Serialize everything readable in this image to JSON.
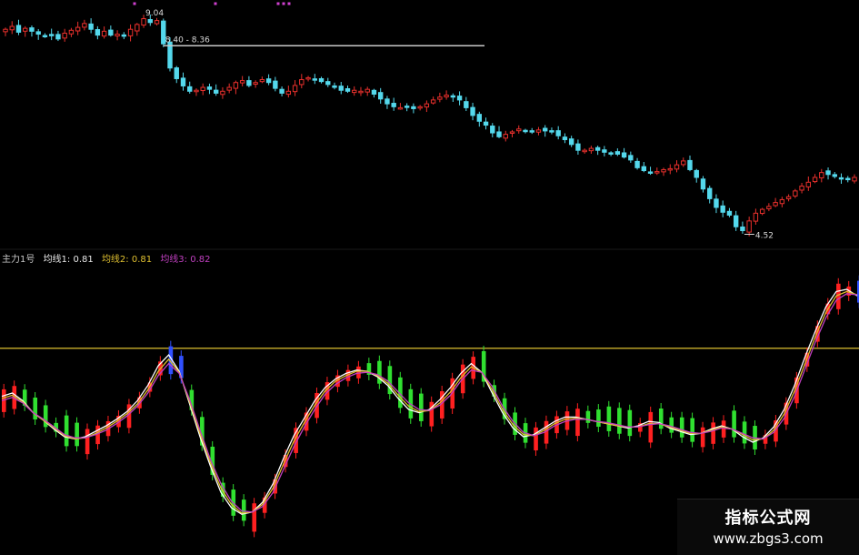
{
  "chart_data": [
    {
      "type": "candlestick",
      "title": "",
      "grid": false,
      "xlabel": "",
      "ylabel": "",
      "ylim": [
        4.4,
        9.1
      ],
      "annotations": {
        "high_label": "9.04",
        "range_label": "8.40 - 8.36",
        "low_label": "4.52"
      },
      "closes": [
        8.72,
        8.78,
        8.66,
        8.74,
        8.68,
        8.62,
        8.58,
        8.6,
        8.52,
        8.64,
        8.7,
        8.76,
        8.84,
        8.72,
        8.6,
        8.68,
        8.6,
        8.62,
        8.58,
        8.72,
        8.82,
        8.94,
        8.86,
        8.9,
        8.42,
        7.92,
        7.7,
        7.55,
        7.44,
        7.46,
        7.52,
        7.48,
        7.4,
        7.44,
        7.52,
        7.62,
        7.66,
        7.56,
        7.62,
        7.68,
        7.62,
        7.5,
        7.4,
        7.44,
        7.56,
        7.68,
        7.72,
        7.68,
        7.64,
        7.58,
        7.52,
        7.46,
        7.44,
        7.46,
        7.44,
        7.48,
        7.38,
        7.28,
        7.18,
        7.12,
        7.1,
        7.12,
        7.08,
        7.12,
        7.18,
        7.26,
        7.32,
        7.36,
        7.32,
        7.26,
        7.1,
        6.94,
        6.82,
        6.74,
        6.58,
        6.5,
        6.55,
        6.6,
        6.66,
        6.62,
        6.6,
        6.64,
        6.62,
        6.62,
        6.52,
        6.44,
        6.34,
        6.22,
        6.22,
        6.26,
        6.22,
        6.18,
        6.16,
        6.14,
        6.08,
        6.02,
        5.86,
        5.8,
        5.76,
        5.78,
        5.82,
        5.84,
        5.92,
        6.0,
        5.82,
        5.66,
        5.42,
        5.22,
        5.04,
        4.94,
        4.88,
        4.64,
        4.56,
        4.76,
        4.92,
        5.0,
        5.06,
        5.14,
        5.2,
        5.26,
        5.38,
        5.48,
        5.56,
        5.66,
        5.76,
        5.72,
        5.68,
        5.64,
        5.62,
        5.66
      ]
    },
    {
      "type": "line",
      "title": "主力1号",
      "grid": false,
      "xlabel": "",
      "ylabel": "",
      "ylim": [
        -0.9,
        1.55
      ],
      "reference_line": 0.86,
      "series": [
        {
          "name": "均线1",
          "label_value": "0.81",
          "color": "#ffffff",
          "values": [
            0.42,
            0.45,
            0.38,
            0.27,
            0.2,
            0.12,
            0.05,
            0.03,
            0.05,
            0.1,
            0.15,
            0.21,
            0.28,
            0.38,
            0.52,
            0.7,
            0.8,
            0.65,
            0.35,
            0.05,
            -0.22,
            -0.46,
            -0.6,
            -0.66,
            -0.64,
            -0.55,
            -0.38,
            -0.15,
            0.06,
            0.22,
            0.38,
            0.5,
            0.58,
            0.63,
            0.66,
            0.65,
            0.6,
            0.52,
            0.4,
            0.3,
            0.27,
            0.3,
            0.39,
            0.5,
            0.63,
            0.72,
            0.64,
            0.45,
            0.27,
            0.13,
            0.05,
            0.07,
            0.13,
            0.19,
            0.23,
            0.23,
            0.21,
            0.19,
            0.17,
            0.15,
            0.13,
            0.15,
            0.19,
            0.18,
            0.13,
            0.1,
            0.07,
            0.08,
            0.12,
            0.15,
            0.12,
            0.05,
            0.0,
            0.04,
            0.14,
            0.3,
            0.52,
            0.78,
            1.02,
            1.24,
            1.38,
            1.4,
            1.34
          ]
        },
        {
          "name": "均线2",
          "label_value": "0.81",
          "color": "#e0c030",
          "values": [
            0.4,
            0.43,
            0.37,
            0.27,
            0.2,
            0.13,
            0.06,
            0.03,
            0.04,
            0.08,
            0.13,
            0.19,
            0.26,
            0.35,
            0.48,
            0.65,
            0.76,
            0.64,
            0.37,
            0.08,
            -0.19,
            -0.42,
            -0.57,
            -0.65,
            -0.64,
            -0.57,
            -0.42,
            -0.2,
            0.01,
            0.18,
            0.34,
            0.47,
            0.56,
            0.61,
            0.65,
            0.65,
            0.61,
            0.54,
            0.43,
            0.33,
            0.28,
            0.29,
            0.36,
            0.46,
            0.59,
            0.69,
            0.64,
            0.48,
            0.3,
            0.16,
            0.07,
            0.06,
            0.11,
            0.17,
            0.21,
            0.22,
            0.21,
            0.19,
            0.17,
            0.15,
            0.14,
            0.14,
            0.17,
            0.17,
            0.14,
            0.11,
            0.08,
            0.08,
            0.11,
            0.14,
            0.12,
            0.07,
            0.02,
            0.03,
            0.11,
            0.26,
            0.47,
            0.72,
            0.97,
            1.19,
            1.34,
            1.38,
            1.35
          ]
        },
        {
          "name": "均线3",
          "label_value": "0.82",
          "color": "#c040c0",
          "values": [
            0.38,
            0.41,
            0.36,
            0.27,
            0.21,
            0.14,
            0.07,
            0.04,
            0.04,
            0.07,
            0.11,
            0.17,
            0.24,
            0.33,
            0.45,
            0.61,
            0.72,
            0.63,
            0.39,
            0.11,
            -0.16,
            -0.38,
            -0.54,
            -0.63,
            -0.64,
            -0.59,
            -0.46,
            -0.25,
            -0.04,
            0.14,
            0.3,
            0.44,
            0.53,
            0.59,
            0.63,
            0.64,
            0.62,
            0.56,
            0.46,
            0.36,
            0.3,
            0.29,
            0.34,
            0.43,
            0.56,
            0.66,
            0.64,
            0.51,
            0.33,
            0.19,
            0.09,
            0.06,
            0.09,
            0.15,
            0.19,
            0.21,
            0.21,
            0.19,
            0.18,
            0.16,
            0.14,
            0.14,
            0.16,
            0.17,
            0.15,
            0.12,
            0.09,
            0.08,
            0.1,
            0.13,
            0.12,
            0.08,
            0.04,
            0.03,
            0.09,
            0.22,
            0.42,
            0.67,
            0.92,
            1.14,
            1.3,
            1.36,
            1.35
          ]
        }
      ]
    }
  ],
  "colors": {
    "up_candle": "#e8302c",
    "down_candle": "#54d8ec",
    "histogram_up": "#ff2020",
    "histogram_down": "#30e030",
    "histogram_peak": "#3050ff",
    "reference_line": "#b8a028",
    "range_line": "#c8c8c8",
    "top_marker": "#d040d0"
  },
  "legend": {
    "indicator_name": "主力1号",
    "ma1_label": "均线1: 0.81",
    "ma2_label": "均线2: 0.81",
    "ma3_label": "均线3: 0.82"
  },
  "watermark": {
    "title": "指标公式网",
    "url": "www.zbgs3.com"
  }
}
